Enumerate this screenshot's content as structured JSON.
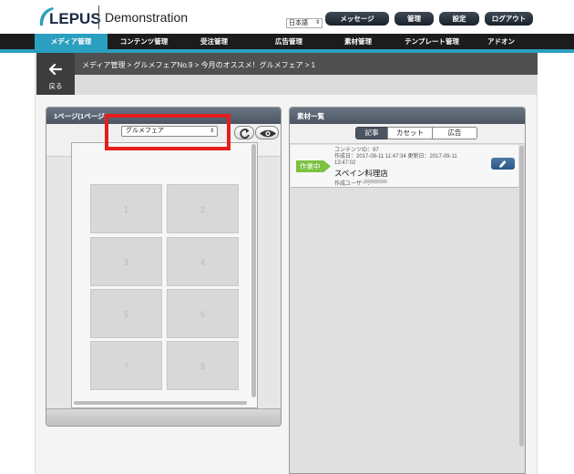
{
  "header": {
    "logo_text": "LEPUS",
    "app_title": "Demonstration",
    "language": "日本語",
    "buttons": {
      "message": "メッセージ",
      "admin": "管理",
      "settings": "設定",
      "logout": "ログアウト"
    }
  },
  "nav": {
    "items": [
      {
        "label": "メディア管理",
        "active": true
      },
      {
        "label": "コンテンツ管理"
      },
      {
        "label": "受注管理"
      },
      {
        "label": "広告管理"
      },
      {
        "label": "素材管理"
      },
      {
        "label": "テンプレート管理"
      },
      {
        "label": "アドオン"
      }
    ]
  },
  "breadcrumb": {
    "back_label": "戻る",
    "path": "メディア管理 > グルメフェアNo.9 > 今月のオススメ！グルメフェア > 1"
  },
  "left_panel": {
    "title": "1ページ(1ページ)",
    "magazine_select": "グルメフェア",
    "pages": [
      "1",
      "2",
      "3",
      "4",
      "5",
      "6",
      "7",
      "8"
    ]
  },
  "right_panel": {
    "title": "素材一覧",
    "tabs": {
      "article": "記事",
      "cassette": "カセット",
      "ad": "広告"
    },
    "items": [
      {
        "status": "作業中",
        "content_id": "コンテンツID：97",
        "dates": "作成日：2017-09-11 11:47:34 更新日：2017-09-11",
        "time": "13:47:02",
        "title": "スペイン料理店",
        "author_label": "作成ユーザー："
      }
    ]
  },
  "colors": {
    "accent": "#2a9fbf",
    "status_green": "#7dc142",
    "highlight_red": "#e61e1e"
  }
}
